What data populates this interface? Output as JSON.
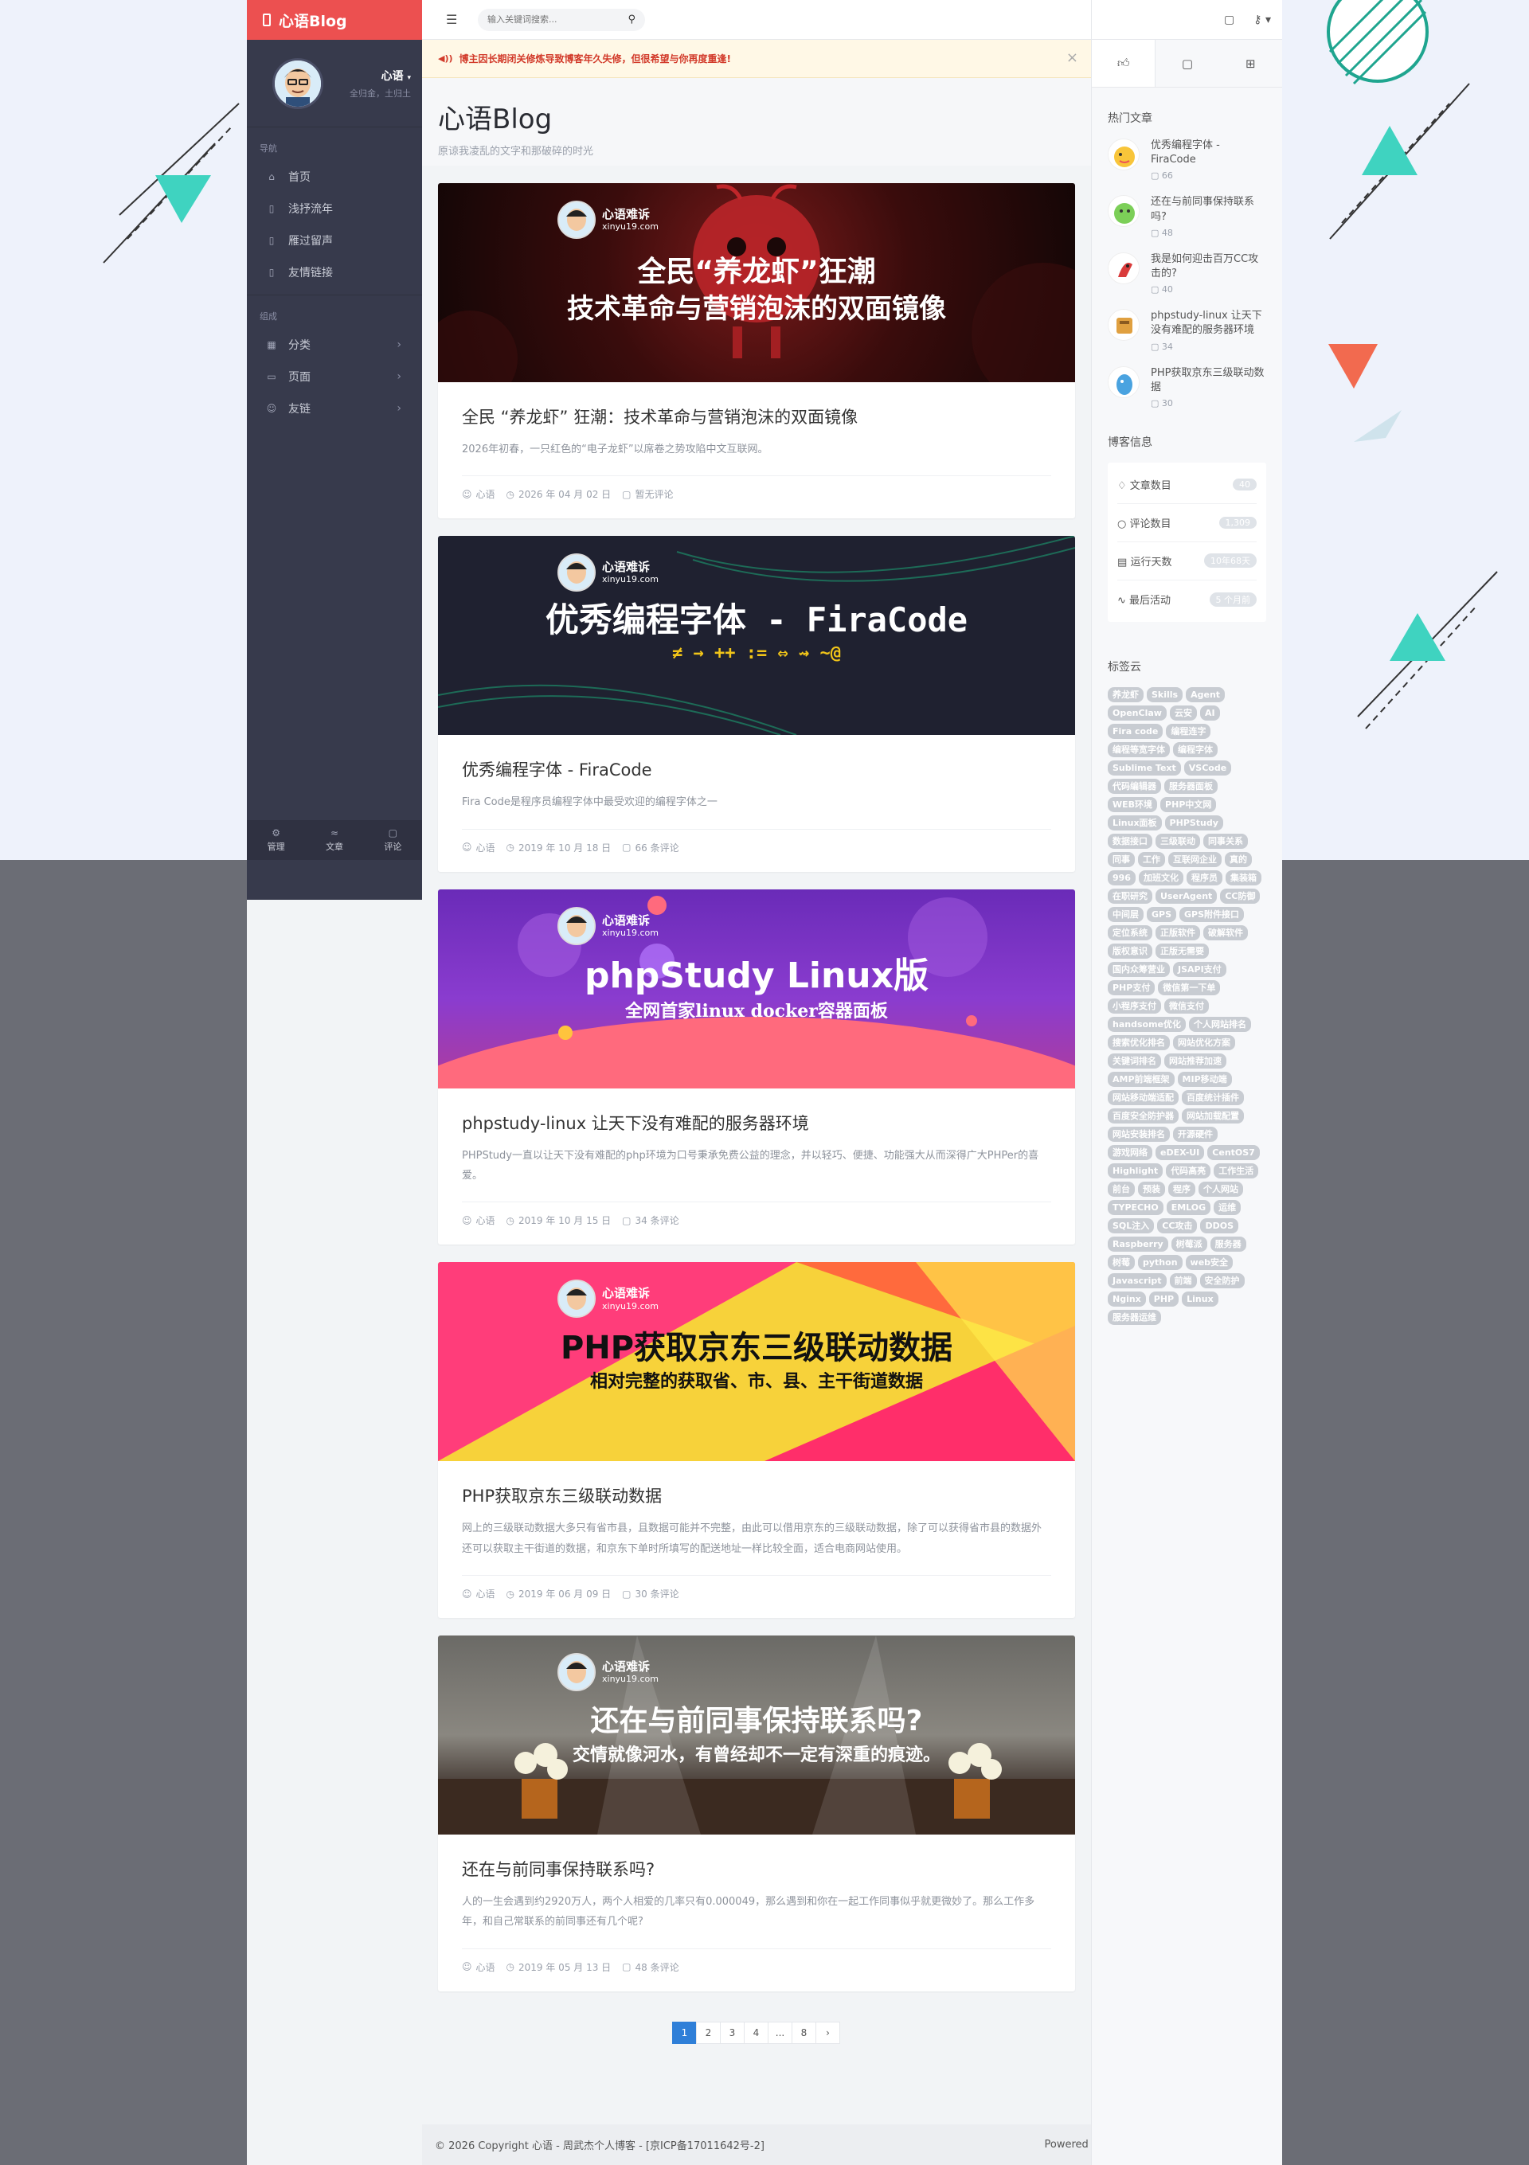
{
  "brand": "心语Blog",
  "profile": {
    "name": "心语",
    "subtitle": "全归金，土归土"
  },
  "nav": {
    "heading": "导航",
    "items": [
      {
        "label": "首页",
        "icon": "home-icon"
      },
      {
        "label": "浅抒流年",
        "icon": "file-icon"
      },
      {
        "label": "雁过留声",
        "icon": "file-icon"
      },
      {
        "label": "友情链接",
        "icon": "file-icon"
      }
    ],
    "group_heading": "组成",
    "group_items": [
      {
        "label": "分类",
        "icon": "grid-icon"
      },
      {
        "label": "页面",
        "icon": "page-icon"
      },
      {
        "label": "友链",
        "icon": "user-icon"
      }
    ],
    "bottom": [
      {
        "label": "管理",
        "icon": "gear-icon"
      },
      {
        "label": "文章",
        "icon": "rss-icon"
      },
      {
        "label": "评论",
        "icon": "comment-icon"
      }
    ]
  },
  "search": {
    "placeholder": "输入关键词搜索..."
  },
  "notice": "博主因长期闭关修炼导致博客年久失修，但很希望与你再度重逢!",
  "header": {
    "title": "心语Blog",
    "subtitle": "原谅我凌乱的文字和那破碎的时光"
  },
  "banner_brand": {
    "title": "心语难诉",
    "site": "xinyu19.com"
  },
  "posts": [
    {
      "banner_line1": "全民“养龙虾”狂潮",
      "banner_line2": "技术革命与营销泡沫的双面镜像",
      "title": "全民 “养龙虾” 狂潮：技术革命与营销泡沫的双面镜像",
      "excerpt": "2026年初春，一只红色的“电子龙虾”以席卷之势攻陷中文互联网。",
      "author": "心语",
      "date": "2026 年 04 月 02 日",
      "comments": "暂无评论"
    },
    {
      "banner_line1": "优秀编程字体 - FiraCode",
      "banner_line2": "≠ → ++ := ⇔ ⇝ ~@",
      "title": "优秀编程字体 - FiraCode",
      "excerpt": "Fira Code是程序员编程字体中最受欢迎的编程字体之一",
      "author": "心语",
      "date": "2019 年 10 月 18 日",
      "comments": "66 条评论"
    },
    {
      "banner_line1": "phpStudy Linux版",
      "banner_line2": "全网首家linux docker容器面板",
      "title": "phpstudy-linux 让天下没有难配的服务器环境",
      "excerpt": "PHPStudy一直以让天下没有难配的php环境为口号秉承免费公益的理念，并以轻巧、便捷、功能强大从而深得广大PHPer的喜爱。",
      "author": "心语",
      "date": "2019 年 10 月 15 日",
      "comments": "34 条评论"
    },
    {
      "banner_line1": "PHP获取京东三级联动数据",
      "banner_line2": "相对完整的获取省、市、县、主干街道数据",
      "title": "PHP获取京东三级联动数据",
      "excerpt": "网上的三级联动数据大多只有省市县，且数据可能并不完整，由此可以借用京东的三级联动数据，除了可以获得省市县的数据外还可以获取主干街道的数据，和京东下单时所填写的配送地址一样比较全面，适合电商网站使用。",
      "author": "心语",
      "date": "2019 年 06 月 09 日",
      "comments": "30 条评论"
    },
    {
      "banner_line1": "还在与前同事保持联系吗?",
      "banner_line2": "交情就像河水，有曾经却不一定有深重的痕迹。",
      "title": "还在与前同事保持联系吗?",
      "excerpt": "人的一生会遇到约2920万人，两个人相爱的几率只有0.000049，那么遇到和你在一起工作同事似乎就更微妙了。那么工作多年，和自己常联系的前同事还有几个呢?",
      "author": "心语",
      "date": "2019 年 05 月 13 日",
      "comments": "48 条评论"
    }
  ],
  "pagination": [
    "1",
    "2",
    "3",
    "4",
    "...",
    "8",
    "›"
  ],
  "footer": {
    "left": "© 2026 Copyright 心语 - 周武杰个人博客 - [京ICP备17011642号-2]",
    "right": "Powered by Typecho | Theme by handsome"
  },
  "aside": {
    "hot_heading": "热门文章",
    "hot": [
      {
        "title": "优秀编程字体 - FiraCode",
        "count": "66"
      },
      {
        "title": "还在与前同事保持联系吗?",
        "count": "48"
      },
      {
        "title": "我是如何迎击百万CC攻击的?",
        "count": "40"
      },
      {
        "title": "phpstudy-linux 让天下没有难配的服务器环境",
        "count": "34"
      },
      {
        "title": "PHP获取京东三级联动数据",
        "count": "30"
      }
    ],
    "info_heading": "博客信息",
    "info": [
      {
        "label": "文章数目",
        "value": "40"
      },
      {
        "label": "评论数目",
        "value": "1,309"
      },
      {
        "label": "运行天数",
        "value": "10年68天"
      },
      {
        "label": "最后活动",
        "value": "5 个月前"
      }
    ],
    "tags_heading": "标签云",
    "tags": [
      "养龙虾",
      "Skills",
      "Agent",
      "OpenClaw",
      "云安",
      "AI",
      "Fira code",
      "编程连字",
      "编程等宽字体",
      "编程字体",
      "Sublime Text",
      "VSCode",
      "代码编辑器",
      "服务器面板",
      "WEB环境",
      "PHP中文网",
      "Linux面板",
      "PHPStudy",
      "数据接口",
      "三级联动",
      "同事关系",
      "同事",
      "工作",
      "互联网企业",
      "真的",
      "996",
      "加班文化",
      "程序员",
      "集装箱",
      "在职研究",
      "UserAgent",
      "CC防御",
      "中间层",
      "GPS",
      "GPS附件接口",
      "定位系统",
      "正版软件",
      "破解软件",
      "版权意识",
      "正版无需要",
      "国内众筹营业",
      "JSAPI支付",
      "PHP支付",
      "微信第一下单",
      "小程序支付",
      "微信支付",
      "handsome优化",
      "个人网站排名",
      "搜索优化排名",
      "网站优化方案",
      "关键词排名",
      "网站推荐加速",
      "AMP前端框架",
      "MIP移动端",
      "网站移动端适配",
      "百度统计插件",
      "百度安全防护器",
      "网站加载配置",
      "网站安装排名",
      "开源硬件",
      "游戏网络",
      "eDEX-UI",
      "CentOS7",
      "Highlight",
      "代码高亮",
      "工作生活",
      "前台",
      "预装",
      "程序",
      "个人网站",
      "TYPECHO",
      "EMLOG",
      "运维",
      "SQL注入",
      "CC攻击",
      "DDOS",
      "Raspberry",
      "树莓派",
      "服务器",
      "树莓",
      "python",
      "web安全",
      "Javascript",
      "前端",
      "安全防护",
      "Nginx",
      "PHP",
      "Linux",
      "服务器运维"
    ]
  },
  "colors": {
    "accent": "#ec5050",
    "sidebar": "#373a4c",
    "pager_active": "#2f7fd8"
  }
}
